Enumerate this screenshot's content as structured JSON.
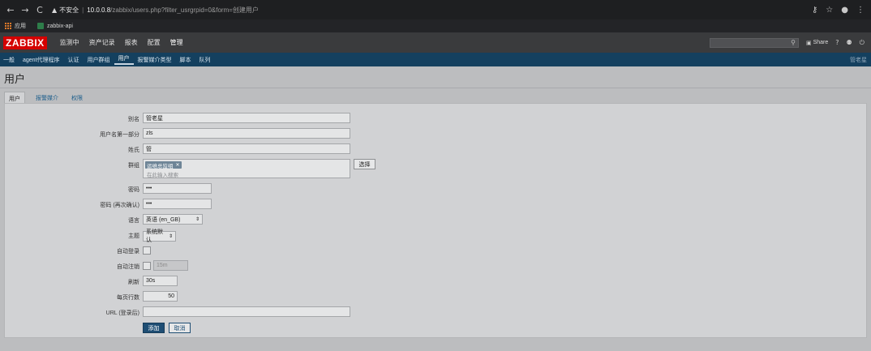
{
  "browser": {
    "back": "←",
    "forward": "→",
    "reload": "C",
    "insecure_label": "不安全",
    "url_host": "10.0.0.8",
    "url_rest": "/zabbix/users.php?filter_usrgrpid=0&form=创建用户",
    "bookmarks": [
      {
        "label": "应用",
        "icon": "apps-grid-icon"
      },
      {
        "label": "zabbix-api",
        "icon": "bookmark-favicon"
      }
    ]
  },
  "header": {
    "logo": "ZABBIX",
    "menu": [
      "监测中",
      "资产记录",
      "报表",
      "配置",
      "管理"
    ],
    "active_menu": "管理",
    "share_label": "Share",
    "help": "?"
  },
  "submenu": {
    "items": [
      "一般",
      "agent代理程序",
      "认证",
      "用户群组",
      "用户",
      "报警媒介类型",
      "脚本",
      "队列"
    ],
    "active": "用户",
    "user_name": "管老星"
  },
  "page": {
    "title": "用户",
    "tabs": [
      "用户",
      "报警媒介",
      "权限"
    ],
    "active_tab": "用户"
  },
  "form": {
    "alias_label": "别名",
    "alias_value": "管老星",
    "name_label": "用户名第一部分",
    "name_value": "zls",
    "surname_label": "姓氏",
    "surname_value": "管",
    "groups_label": "群组",
    "groups_tag": "运维总监组",
    "groups_placeholder": "在此输入搜索",
    "select_button": "选择",
    "password_label": "密码",
    "password_value": "•••",
    "password2_label": "密码 (再次确认)",
    "password2_value": "•••",
    "language_label": "语言",
    "language_value": "英语 (en_GB)",
    "theme_label": "主题",
    "theme_value": "系统默认",
    "autologin_label": "自动登录",
    "autologout_label": "自动注销",
    "autologout_value": "15m",
    "refresh_label": "刷新",
    "refresh_value": "30s",
    "rows_label": "每页行数",
    "rows_value": "50",
    "url_label": "URL (登录后)",
    "url_value": "",
    "add_button": "添加",
    "cancel_button": "取消"
  }
}
